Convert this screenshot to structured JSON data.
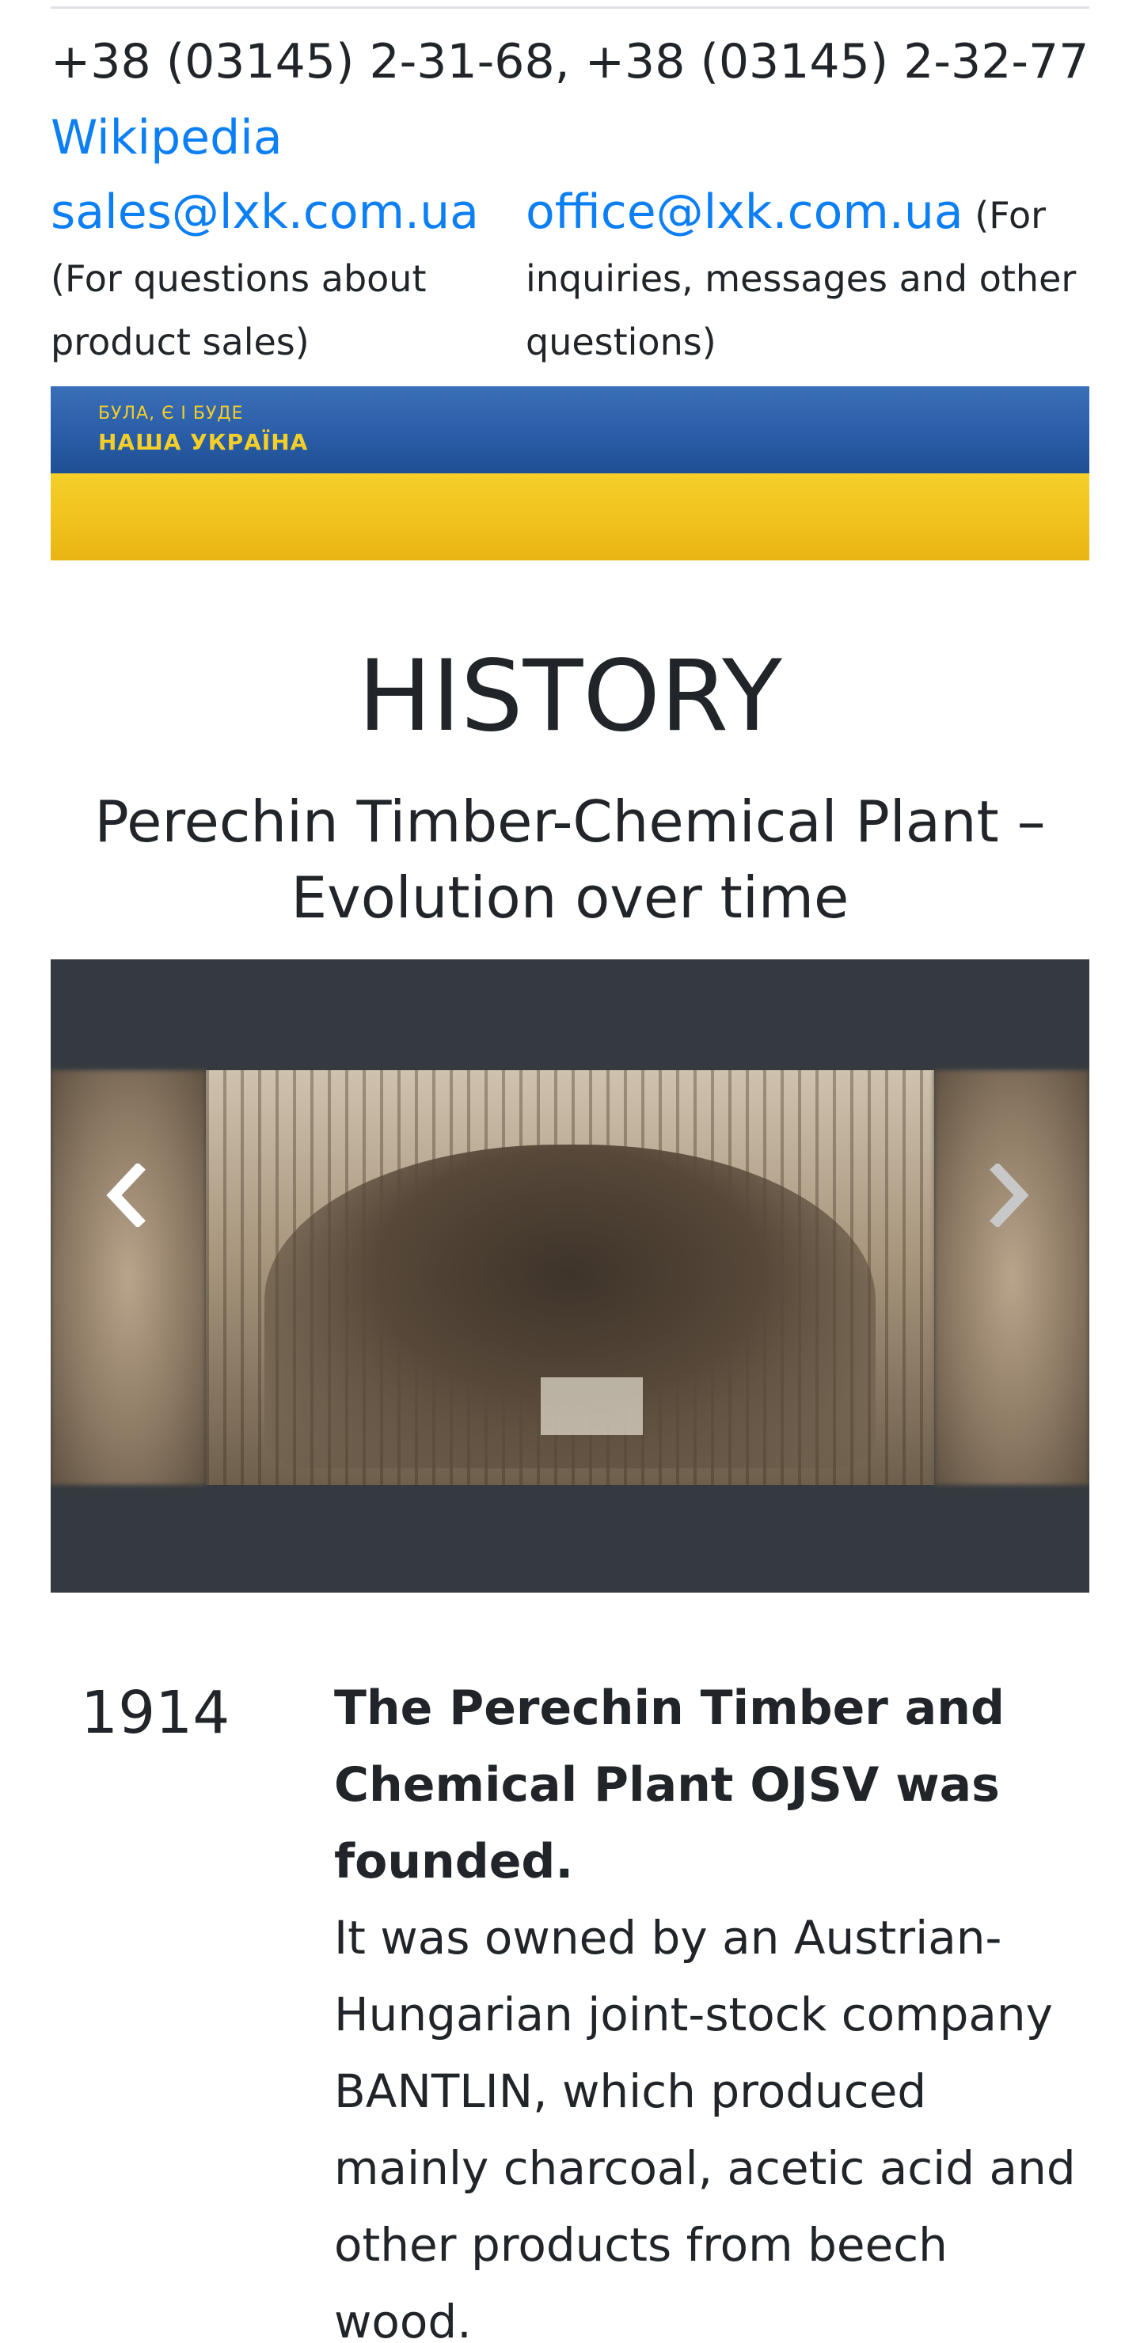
{
  "contacts": {
    "phone": "+38 (03145) 2-31-68,  +38 (03145) 2-32-77",
    "wikipedia_label": "Wikipedia",
    "sales_email": "sales@lxk.com.ua",
    "sales_note": " (For questions about product sales)",
    "office_email": "office@lxk.com.ua",
    "office_note": " (For inquiries, messages and other questions)"
  },
  "banner": {
    "slogan_line1": "БУЛА, Є І БУДЕ",
    "slogan_line2": "НАША УКРАЇНА",
    "colors": {
      "blue": "#2a5ea8",
      "yellow": "#f1c21d"
    }
  },
  "history": {
    "title": "HISTORY",
    "subtitle": "Perechin Timber-Chemical Plant – Evolution over time"
  },
  "carousel": {
    "prev_icon": "chevron-left-icon",
    "next_icon": "chevron-right-icon",
    "background": "#343a40"
  },
  "timeline": [
    {
      "year": "1914",
      "headline": "The Perechin Timber and Chemical Plant OJSV was founded.",
      "text": "It was owned by an Austrian-Hungarian joint-stock company BANTLIN, which produced mainly charcoal, acetic acid and other products from beech wood."
    }
  ],
  "colors": {
    "link": "#0d7ff5",
    "text": "#212529"
  }
}
